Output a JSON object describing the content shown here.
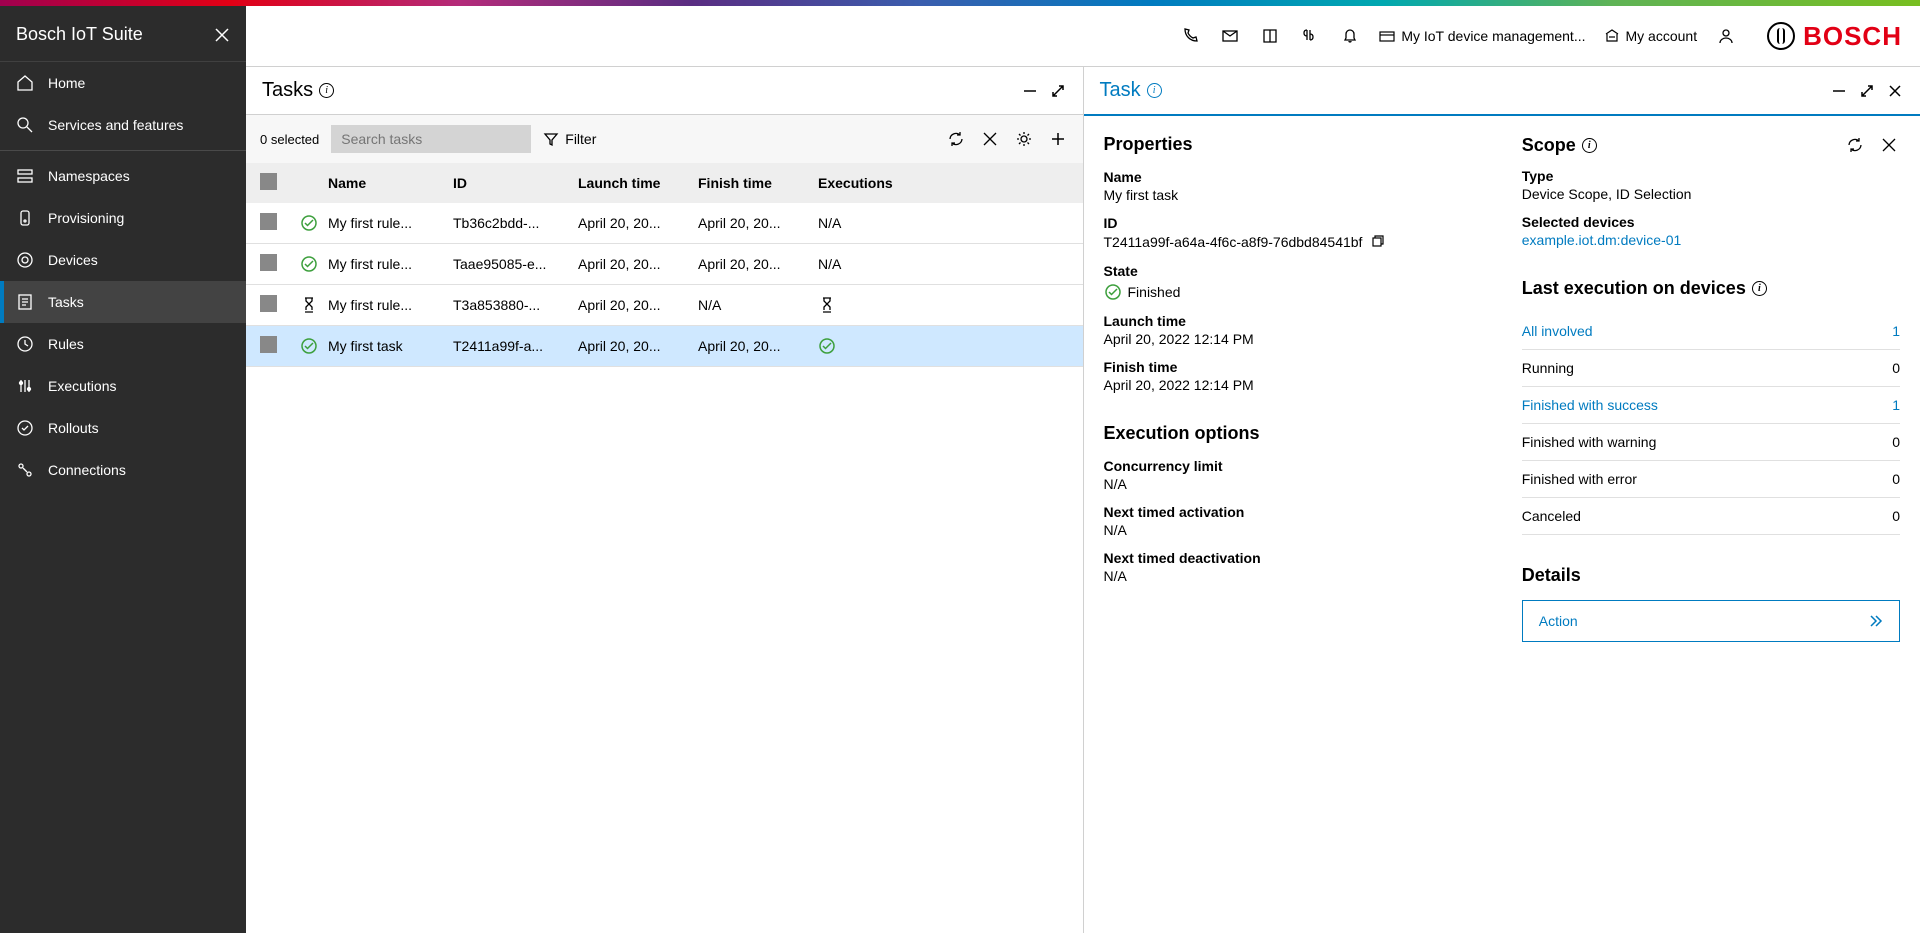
{
  "sidebar": {
    "title": "Bosch IoT Suite",
    "items": [
      {
        "label": "Home",
        "icon": "home"
      },
      {
        "label": "Services and features",
        "icon": "wrench"
      }
    ],
    "items2": [
      {
        "label": "Namespaces",
        "icon": "ns"
      },
      {
        "label": "Provisioning",
        "icon": "prov"
      },
      {
        "label": "Devices",
        "icon": "devices"
      },
      {
        "label": "Tasks",
        "icon": "tasks",
        "active": true
      },
      {
        "label": "Rules",
        "icon": "rules"
      },
      {
        "label": "Executions",
        "icon": "exec"
      },
      {
        "label": "Rollouts",
        "icon": "rollouts"
      },
      {
        "label": "Connections",
        "icon": "conn"
      }
    ]
  },
  "topbar": {
    "device_mgmt": "My IoT device management...",
    "my_account": "My account",
    "brand": "BOSCH"
  },
  "tasks_panel": {
    "title": "Tasks",
    "selected": "0 selected",
    "search_placeholder": "Search tasks",
    "filter": "Filter",
    "columns": {
      "name": "Name",
      "id": "ID",
      "launch": "Launch time",
      "finish": "Finish time",
      "exec": "Executions"
    },
    "rows": [
      {
        "status": "finished",
        "name": "My first rule...",
        "id": "Tb36c2bdd-...",
        "launch": "April 20, 20...",
        "finish": "April 20, 20...",
        "exec": "N/A"
      },
      {
        "status": "finished",
        "name": "My first rule...",
        "id": "Taae95085-e...",
        "launch": "April 20, 20...",
        "finish": "April 20, 20...",
        "exec": "N/A"
      },
      {
        "status": "running",
        "name": "My first rule...",
        "id": "T3a853880-...",
        "launch": "April 20, 20...",
        "finish": "N/A",
        "exec": "hourglass"
      },
      {
        "status": "finished",
        "name": "My first task",
        "id": "T2411a99f-a...",
        "launch": "April 20, 20...",
        "finish": "April 20, 20...",
        "exec": "check",
        "selected": true
      }
    ]
  },
  "task_panel": {
    "title": "Task",
    "properties": {
      "heading": "Properties",
      "name_label": "Name",
      "name": "My first task",
      "id_label": "ID",
      "id": "T2411a99f-a64a-4f6c-a8f9-76dbd84541bf",
      "state_label": "State",
      "state": "Finished",
      "launch_label": "Launch time",
      "launch": "April 20, 2022 12:14 PM",
      "finish_label": "Finish time",
      "finish": "April 20, 2022 12:14 PM"
    },
    "exec_options": {
      "heading": "Execution options",
      "concurrency_label": "Concurrency limit",
      "concurrency": "N/A",
      "next_act_label": "Next timed activation",
      "next_act": "N/A",
      "next_deact_label": "Next timed deactivation",
      "next_deact": "N/A"
    },
    "scope": {
      "heading": "Scope",
      "type_label": "Type",
      "type": "Device Scope, ID Selection",
      "selected_devices_label": "Selected devices",
      "device_link": "example.iot.dm:device-01"
    },
    "last_exec": {
      "heading": "Last execution on devices",
      "rows": [
        {
          "label": "All involved",
          "count": "1",
          "link": true
        },
        {
          "label": "Running",
          "count": "0"
        },
        {
          "label": "Finished with success",
          "count": "1",
          "link": true
        },
        {
          "label": "Finished with warning",
          "count": "0"
        },
        {
          "label": "Finished with error",
          "count": "0"
        },
        {
          "label": "Canceled",
          "count": "0"
        }
      ]
    },
    "details": {
      "heading": "Details",
      "action": "Action"
    }
  }
}
